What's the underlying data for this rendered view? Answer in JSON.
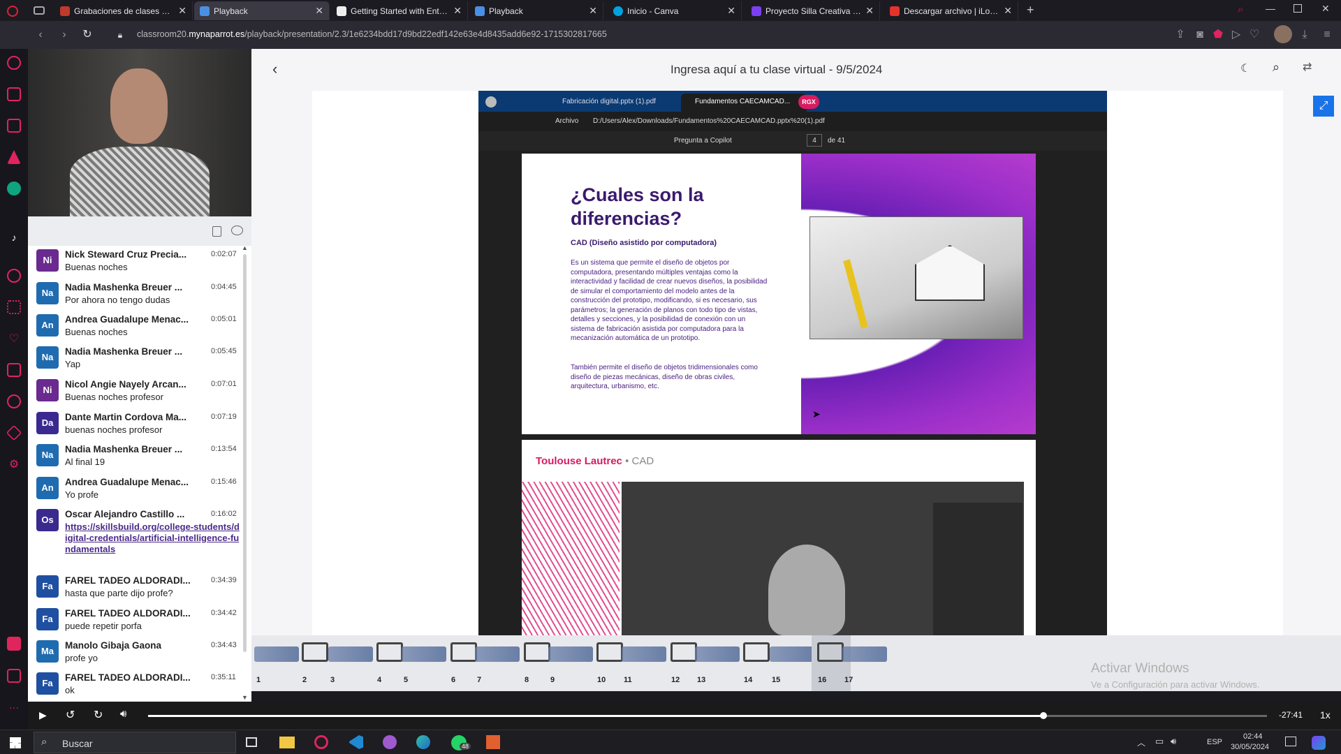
{
  "tabs": [
    {
      "label": "Grabaciones de clases ante",
      "color": "#c0392b"
    },
    {
      "label": "Playback",
      "color": "#4a90e2"
    },
    {
      "label": "Getting Started with Enterp",
      "color": "#333333"
    },
    {
      "label": "Playback",
      "color": "#4a90e2"
    },
    {
      "label": "Inicio - Canva",
      "color": "#00a3e0"
    },
    {
      "label": "Proyecto Silla Creativa - Pr",
      "color": "#7b3ff2"
    },
    {
      "label": "Descargar archivo | iLovePD",
      "color": "#e5322d"
    }
  ],
  "url": {
    "prefix": "classroom20.",
    "domain": "mynaparrot.es",
    "path": "/playback/presentation/2.3/1e6234bdd17d9bd22edf142e63e4d8435add6e92-1715302817665"
  },
  "main": {
    "title": "Ingresa aquí a tu clase virtual - 9/5/2024"
  },
  "chat": {
    "messages": [
      {
        "initials": "Ni",
        "color": "#6a2a8f",
        "name": "Nick Steward Cruz Precia...",
        "time": "0:02:07",
        "text": "Buenas noches"
      },
      {
        "initials": "Na",
        "color": "#1f6bb0",
        "name": "Nadia Mashenka Breuer ...",
        "time": "0:04:45",
        "text": "Por ahora no tengo dudas"
      },
      {
        "initials": "An",
        "color": "#1f6bb0",
        "name": "Andrea Guadalupe Menac...",
        "time": "0:05:01",
        "text": "Buenas noches"
      },
      {
        "initials": "Na",
        "color": "#1f6bb0",
        "name": "Nadia Mashenka Breuer ...",
        "time": "0:05:45",
        "text": "Yap"
      },
      {
        "initials": "Ni",
        "color": "#6a2a8f",
        "name": "Nicol Angie Nayely Arcan...",
        "time": "0:07:01",
        "text": "Buenas noches profesor"
      },
      {
        "initials": "Da",
        "color": "#3a2a8f",
        "name": "Dante Martin Cordova Ma...",
        "time": "0:07:19",
        "text": "buenas noches profesor"
      },
      {
        "initials": "Na",
        "color": "#1f6bb0",
        "name": "Nadia Mashenka Breuer ...",
        "time": "0:13:54",
        "text": "Al final  19"
      },
      {
        "initials": "An",
        "color": "#1f6bb0",
        "name": "Andrea Guadalupe Menac...",
        "time": "0:15:46",
        "text": "Yo profe"
      },
      {
        "initials": "Os",
        "color": "#3a2a8f",
        "name": "Oscar Alejandro Castillo ...",
        "time": "0:16:02",
        "text": "https://skillsbuild.org/college-students/digital-credentials/artificial-intelligence-fundamentals",
        "link": true
      },
      {
        "initials": "Fa",
        "color": "#1f4fa0",
        "name": "FAREL TADEO ALDORADI...",
        "time": "0:34:39",
        "text": "hasta que parte dijo profe?"
      },
      {
        "initials": "Fa",
        "color": "#1f4fa0",
        "name": "FAREL TADEO ALDORADI...",
        "time": "0:34:42",
        "text": "puede repetir porfa"
      },
      {
        "initials": "Ma",
        "color": "#1f6bb0",
        "name": "Manolo Gibaja Gaona",
        "time": "0:34:43",
        "text": "profe yo"
      },
      {
        "initials": "Fa",
        "color": "#1f4fa0",
        "name": "FAREL TADEO ALDORADI...",
        "time": "0:35:11",
        "text": "ok"
      }
    ]
  },
  "share": {
    "tab1": "Fabricación digital.pptx (1).pdf",
    "tab2": "Fundamentos CAECAMCAD...",
    "archivo": "Archivo",
    "path": "D:/Users/Alex/Downloads/Fundamentos%20CAECAMCAD.pptx%20(1).pdf",
    "copilot": "Pregunta a Copilot",
    "page": "4",
    "of": "de 41",
    "slide_title": "¿Cuales son la diferencias?",
    "cad_label": "CAD (Diseño asistido por computadora)",
    "para1": "Es un sistema que permite el diseño de objetos por computadora, presentando múltiples ventajas como la interactividad y facilidad de crear nuevos diseños, la posibilidad de simular el comportamiento del modelo antes de la construcción del prototipo, modificando, si es necesario, sus parámetros; la generación de planos con todo tipo de vistas, detalles y secciones, y la posibilidad de conexión con un sistema de fabricación asistida por computadora para la mecanización automática de un prototipo.",
    "para2": "También permite el diseño de objetos tridimensionales como diseño de piezas mecánicas, diseño de obras civiles, arquitectura, urbanismo, etc.",
    "brand_red": "Toulouse Lautrec",
    "brand_grey": "• CAD",
    "badge": "RGX"
  },
  "thumbs": [
    "1",
    "2",
    "3",
    "4",
    "5",
    "6",
    "7",
    "8",
    "9",
    "10",
    "11",
    "12",
    "13",
    "14",
    "15",
    "16",
    "17"
  ],
  "watermark": {
    "title": "Activar Windows",
    "sub": "Ve a Configuración para activar Windows."
  },
  "controls": {
    "remaining": "-27:41",
    "speed": "1x",
    "progress": 0.8
  },
  "taskbar": {
    "search": "Buscar",
    "lang": "ESP",
    "time": "02:44",
    "date": "30/05/2024",
    "whatsapp_badge": "48"
  }
}
